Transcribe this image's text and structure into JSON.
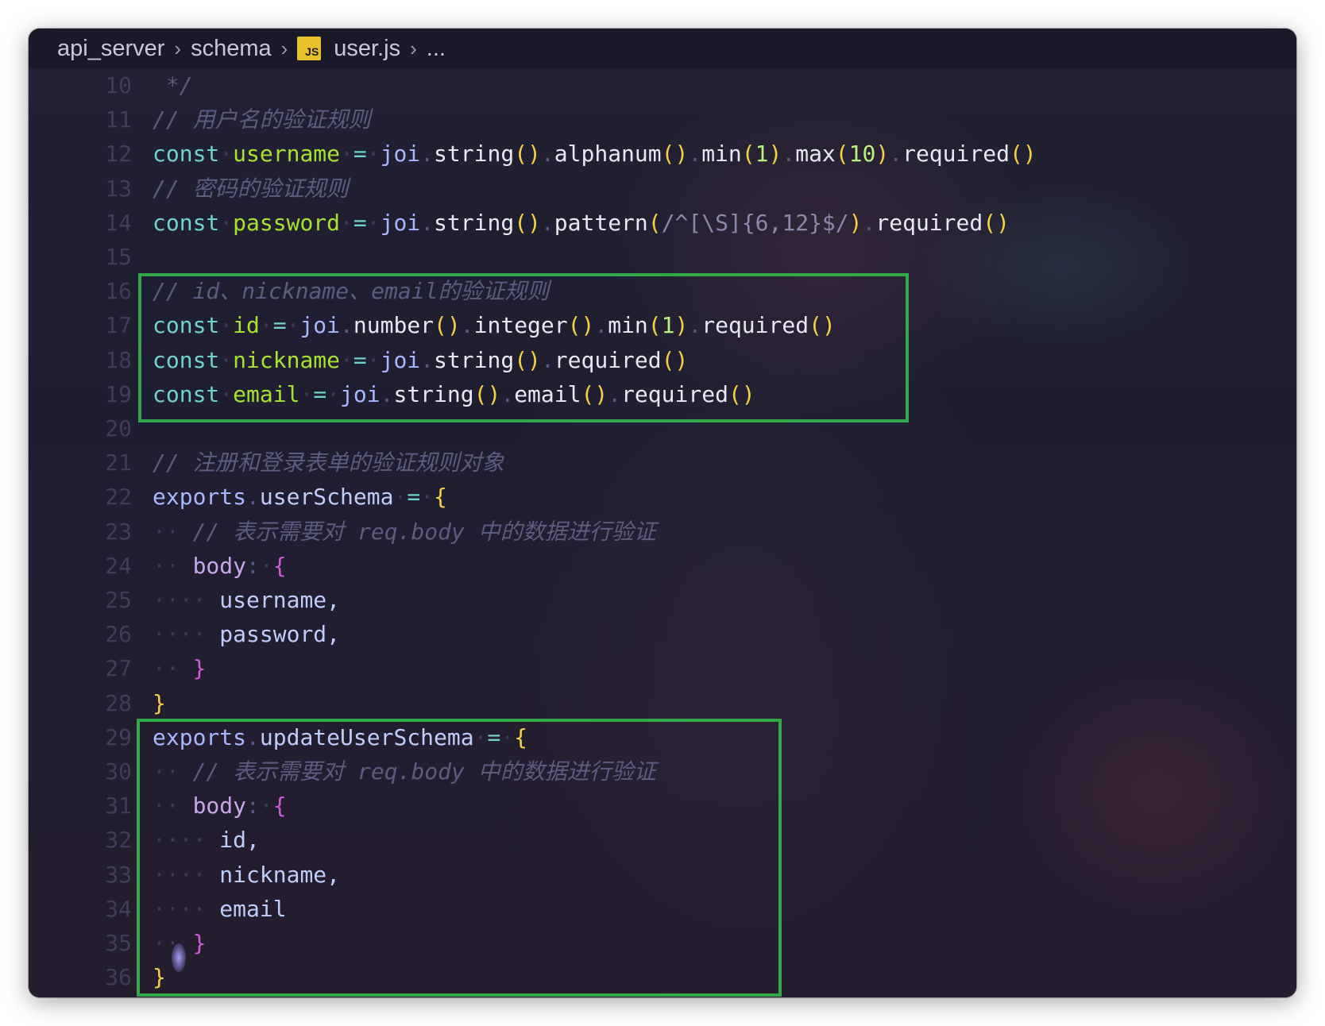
{
  "breadcrumb": {
    "folder": "api_server",
    "subfolder": "schema",
    "file_icon_label": "JS",
    "file": "user.js",
    "more": "..."
  },
  "colors": {
    "highlight_box": "#33a84b",
    "keyword": "#6fd3c5",
    "comment": "#5c5c7e"
  },
  "line_numbers": [
    "10",
    "11",
    "12",
    "13",
    "14",
    "15",
    "16",
    "17",
    "18",
    "19",
    "20",
    "21",
    "22",
    "23",
    "24",
    "25",
    "26",
    "27",
    "28",
    "29",
    "30",
    "31",
    "32",
    "33",
    "34",
    "35",
    "36"
  ],
  "code": {
    "l10": " */",
    "l11": "// 用户名的验证规则",
    "l12": [
      "const",
      " ",
      "username",
      " ",
      "=",
      " ",
      "joi",
      ".",
      "string",
      "()",
      ".",
      "alphanum",
      "()",
      ".",
      "min",
      "(",
      "1",
      ")",
      ".",
      "max",
      "(",
      "10",
      ")",
      ".",
      "required",
      "()"
    ],
    "l13": "// 密码的验证规则",
    "l14": [
      "const",
      " ",
      "password",
      " ",
      "=",
      " ",
      "joi",
      ".",
      "string",
      "()",
      ".",
      "pattern",
      "(",
      "/^[\\S]{6,12}$/",
      ")",
      ".",
      "required",
      "()"
    ],
    "l16": "// id、nickname、email的验证规则",
    "l17": [
      "const",
      " ",
      "id",
      " ",
      "=",
      " ",
      "joi",
      ".",
      "number",
      "()",
      ".",
      "integer",
      "()",
      ".",
      "min",
      "(",
      "1",
      ")",
      ".",
      "required",
      "()"
    ],
    "l18": [
      "const",
      " ",
      "nickname",
      " ",
      "=",
      " ",
      "joi",
      ".",
      "string",
      "()",
      ".",
      "required",
      "()"
    ],
    "l19": [
      "const",
      " ",
      "email",
      " ",
      "=",
      " ",
      "joi",
      ".",
      "string",
      "()",
      ".",
      "email",
      "()",
      ".",
      "required",
      "()"
    ],
    "l21": "// 注册和登录表单的验证规则对象",
    "l22": [
      "exports",
      ".",
      "userSchema",
      " ",
      "=",
      " ",
      "{"
    ],
    "l23": "// 表示需要对 req.body 中的数据进行验证",
    "l24": [
      "body",
      ":",
      " ",
      "{"
    ],
    "l25": "username,",
    "l26": "password,",
    "l27": "}",
    "l28": "}",
    "l29": [
      "exports",
      ".",
      "updateUserSchema",
      " ",
      "=",
      " ",
      "{"
    ],
    "l30": "// 表示需要对 req.body 中的数据进行验证",
    "l31": [
      "body",
      ":",
      " ",
      "{"
    ],
    "l32": "id,",
    "l33": "nickname,",
    "l34": "email",
    "l35": "}",
    "l36": "}"
  }
}
